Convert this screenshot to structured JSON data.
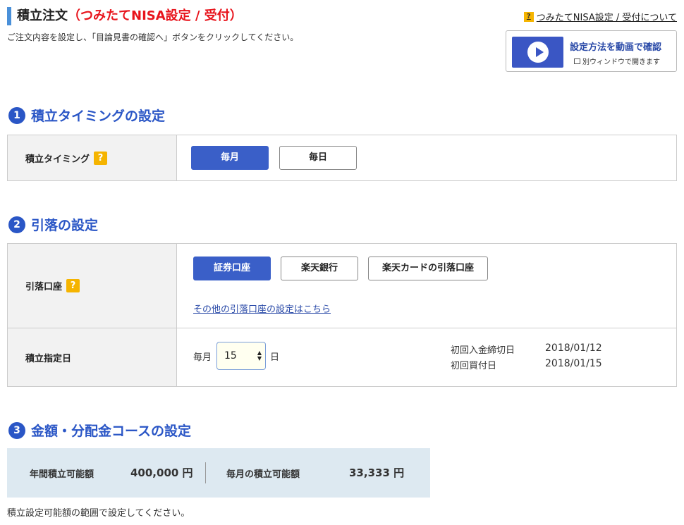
{
  "header": {
    "title_main": "積立注文",
    "title_sub": "（つみたてNISA設定 / 受付）",
    "subtitle": "ご注文内容を設定し、「目論見書の確認へ」ボタンをクリックしてください。",
    "help_icon": "?",
    "help_link": "つみたてNISA設定 / 受付について",
    "video_title": "設定方法を動画で確認",
    "video_sub": "別ウィンドウで開きます"
  },
  "section1": {
    "num": "1",
    "title": "積立タイミングの設定",
    "row_label": "積立タイミング",
    "help": "?",
    "options": [
      "毎月",
      "毎日"
    ],
    "selected": "毎月"
  },
  "section2": {
    "num": "2",
    "title": "引落の設定",
    "account_label": "引落口座",
    "help": "?",
    "accounts": [
      "証券口座",
      "楽天銀行",
      "楽天カードの引落口座"
    ],
    "selected": "証券口座",
    "other_link": "その他の引落口座の設定はこちら",
    "date_label": "積立指定日",
    "date_prefix": "毎月",
    "date_value": "15",
    "date_suffix": "日",
    "first_deposit_label": "初回入金締切日",
    "first_deposit_value": "2018/01/12",
    "first_buy_label": "初回買付日",
    "first_buy_value": "2018/01/15"
  },
  "section3": {
    "num": "3",
    "title": "金額・分配金コースの設定",
    "annual_label": "年間積立可能額",
    "annual_value": "400,000 円",
    "monthly_label": "毎月の積立可能額",
    "monthly_value": "33,333 円",
    "note": "積立設定可能額の範囲で設定してください。"
  },
  "colors": {
    "accent": "#2a56c6",
    "button_active": "#3a5fc8",
    "title_red": "#e8141c",
    "help_badge": "#f5b400",
    "amount_bg": "#dde9f1"
  }
}
